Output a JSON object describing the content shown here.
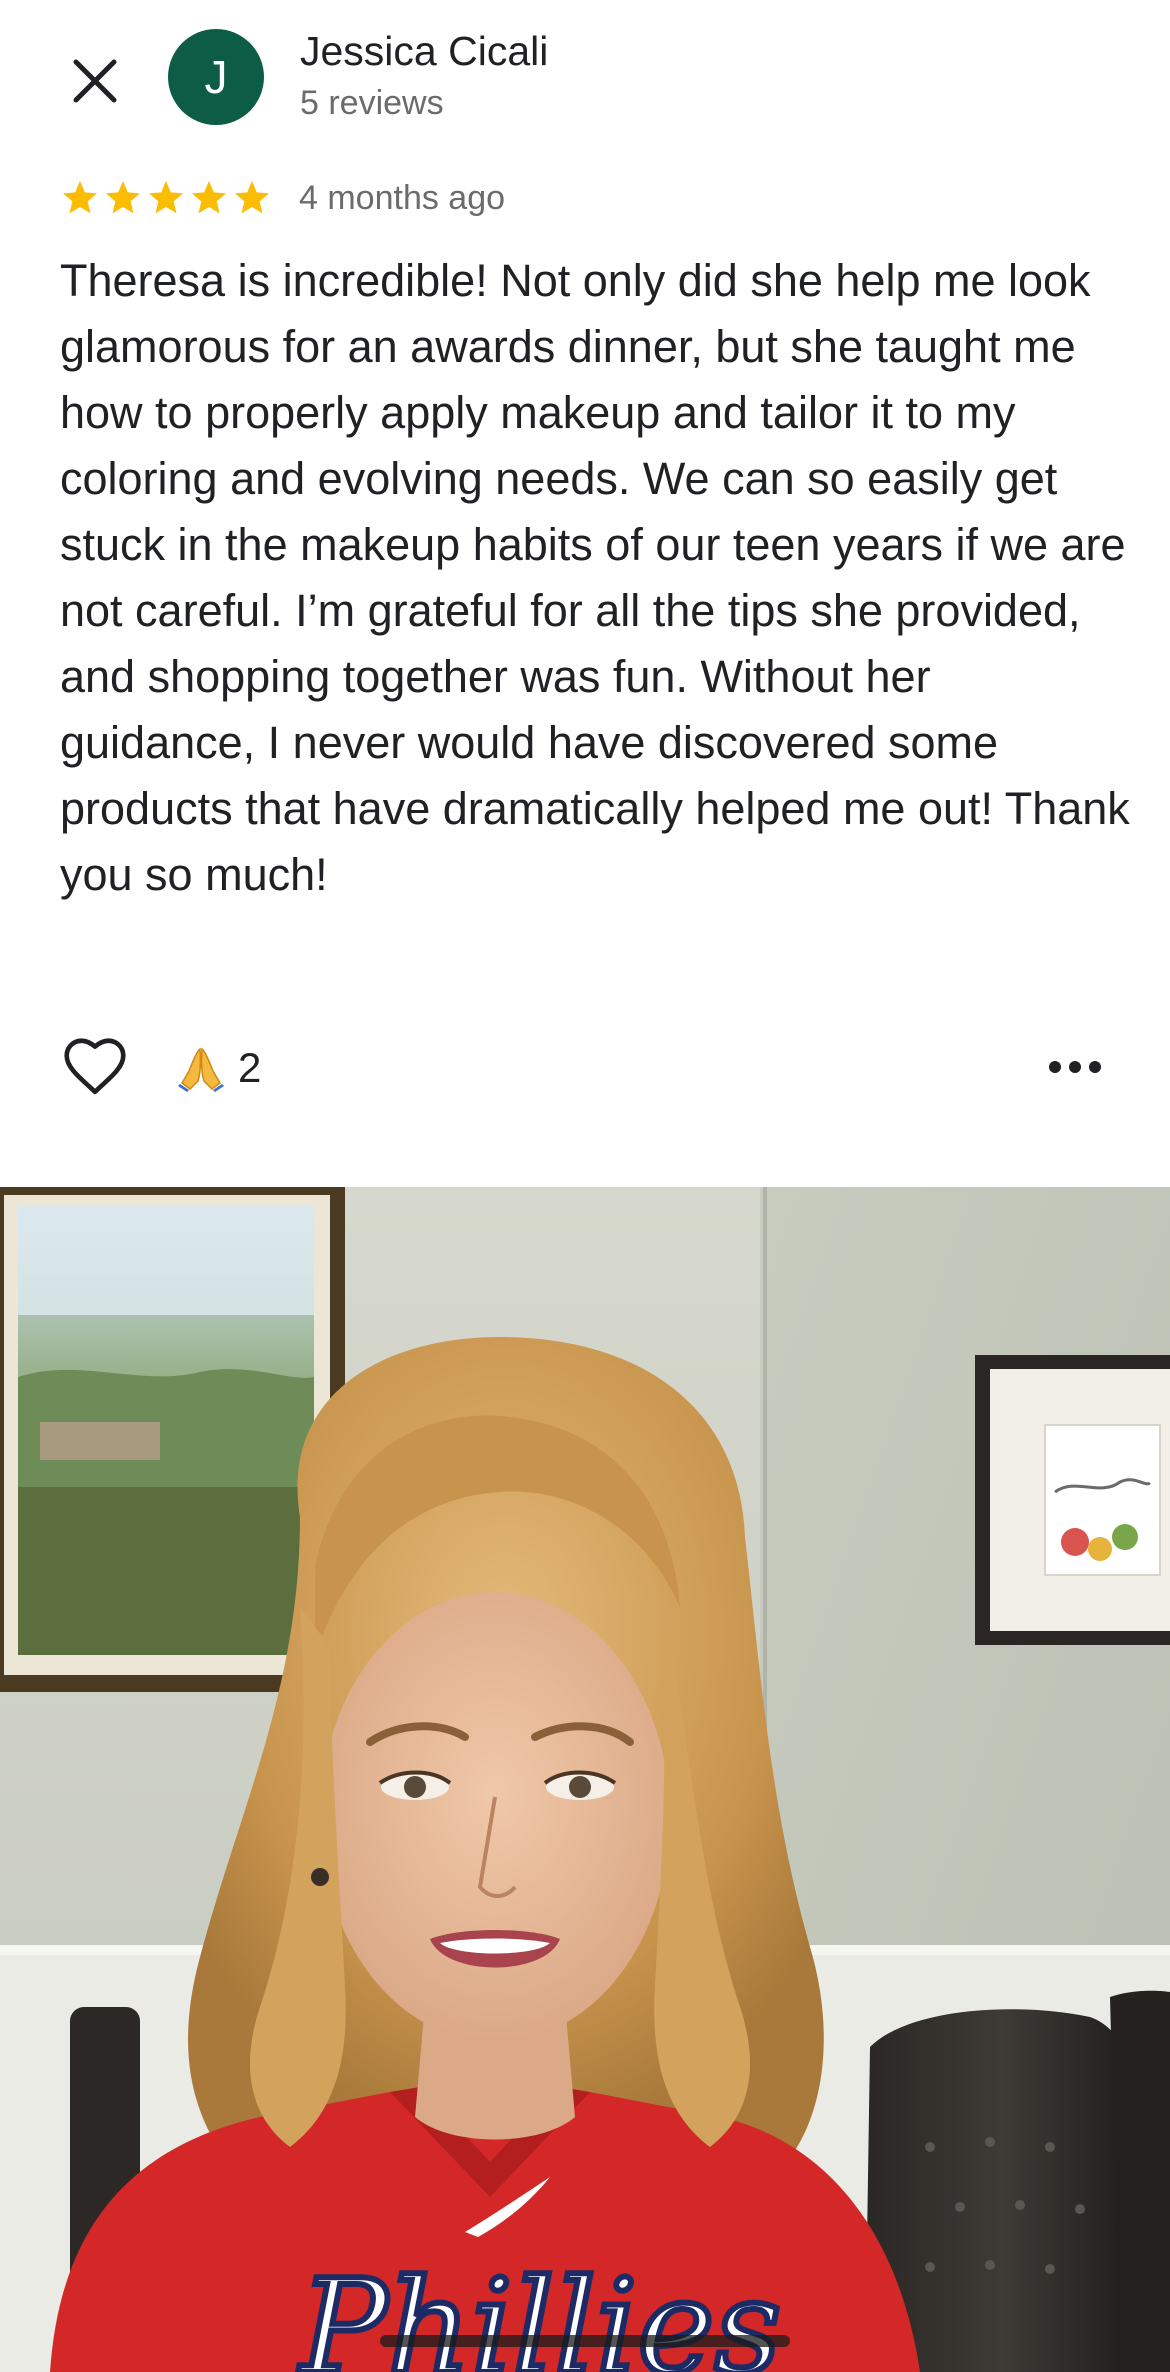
{
  "review": {
    "reviewer": {
      "initial": "J",
      "name": "Jessica Cicali",
      "review_count": "5 reviews",
      "avatar_color": "#0d5c46"
    },
    "rating": 5,
    "star_color": "#fbbc04",
    "date": "4 months ago",
    "text": "Theresa is incredible! Not only did she help me look glamorous for an awards dinner, but she taught me how to properly apply makeup and tailor it to my coloring and evolving needs. We can so easily get stuck in the makeup habits of our teen years if we are not careful. I’m grateful for all the tips she provided, and shopping together was fun. Without her guidance, I never would have discovered some products that have dramatically helped me out! Thank you so much!",
    "reactions": {
      "emoji": "folded-hands",
      "count": "2"
    },
    "icons": {
      "close": "close-icon",
      "like": "heart-outline-icon",
      "more": "more-horizontal-icon"
    }
  }
}
